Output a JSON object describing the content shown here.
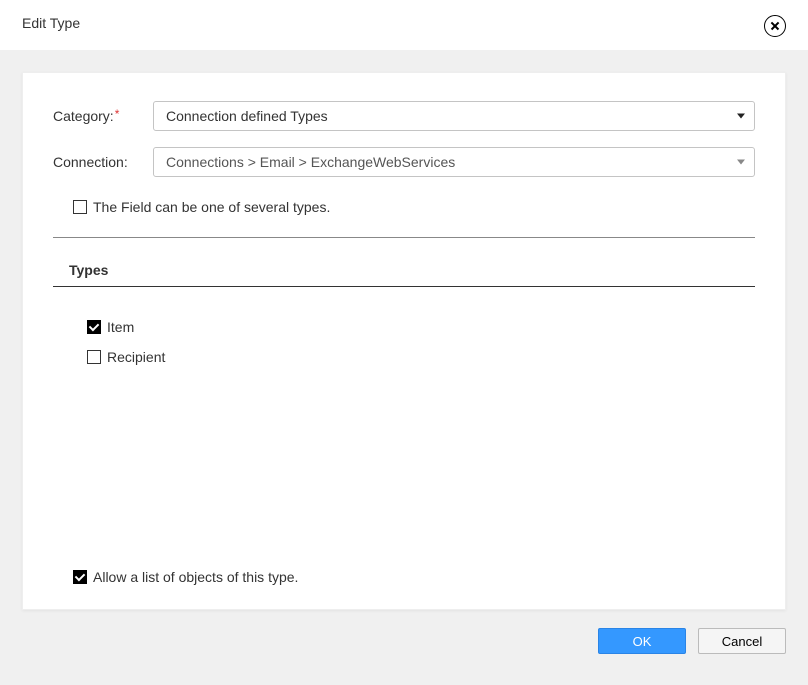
{
  "header": {
    "title": "Edit Type"
  },
  "form": {
    "category": {
      "label": "Category:",
      "required": true,
      "value": "Connection defined Types"
    },
    "connection": {
      "label": "Connection:",
      "value": "Connections > Email > ExchangeWebServices"
    },
    "multiType": {
      "label": "The Field can be one of several types.",
      "checked": false
    }
  },
  "types": {
    "heading": "Types",
    "items": [
      {
        "label": "Item",
        "checked": true
      },
      {
        "label": "Recipient",
        "checked": false
      }
    ]
  },
  "allowList": {
    "label": "Allow a list of objects of this type.",
    "checked": true
  },
  "footer": {
    "ok": "OK",
    "cancel": "Cancel"
  }
}
